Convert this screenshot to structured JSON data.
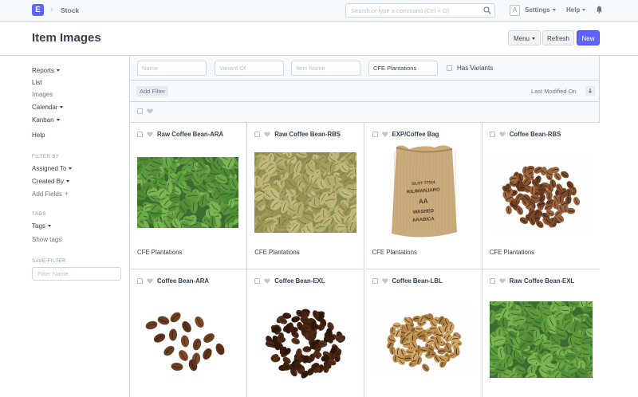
{
  "navbar": {
    "logo_letter": "E",
    "breadcrumb": "Stock",
    "search_placeholder": "Search or type a command (Ctrl + G)",
    "avatar_letter": "A",
    "settings_label": "Settings",
    "help_label": "Help"
  },
  "page": {
    "title": "Item Images",
    "menu_label": "Menu",
    "refresh_label": "Refresh",
    "new_label": "New"
  },
  "sidebar": {
    "views": [
      "Reports",
      "List",
      "Images",
      "Calendar",
      "Kanban",
      "Help"
    ],
    "filter_by_label": "FILTER BY",
    "assigned_to": "Assigned To",
    "created_by": "Created By",
    "add_fields": "Add Fields",
    "tags_label": "TAGS",
    "tags": "Tags",
    "show_tags": "Show tags",
    "save_filter_label": "SAVE FILTER",
    "filter_name_placeholder": "Filter Name"
  },
  "filters": {
    "name_placeholder": "Name",
    "variant_of_placeholder": "Variant Of",
    "item_name_placeholder": "Item Name",
    "item_group_value": "CFE Plantations",
    "has_variants_label": "Has Variants",
    "add_filter_label": "Add Filter",
    "sort_label": "Last Modified On"
  },
  "items": [
    {
      "title": "Raw Coffee Bean-ARA",
      "group": "CFE Plantations",
      "image": "green-coffee-beans"
    },
    {
      "title": "Raw Coffee Bean-RBS",
      "group": "CFE Plantations",
      "image": "pale-green-coffee-beans"
    },
    {
      "title": "EXP/Coffee Bag",
      "group": "CFE Plantations",
      "image": "burlap-coffee-sack"
    },
    {
      "title": "Coffee Bean-RBS",
      "group": "CFE Plantations",
      "image": "roasted-coffee-pile"
    },
    {
      "title": "Coffee Bean-ARA",
      "group": "",
      "image": "roasted-coffee-scatter"
    },
    {
      "title": "Coffee Bean-EXL",
      "group": "",
      "image": "dark-roasted-coffee-pile"
    },
    {
      "title": "Coffee Bean-LBL",
      "group": "",
      "image": "light-roasted-coffee-pile"
    },
    {
      "title": "Raw Coffee Bean-EXL",
      "group": "",
      "image": "green-coffee-beans"
    }
  ],
  "sack_label": [
    "5/LOT 77314",
    "KILIMANJARO",
    "AA",
    "WASHED",
    "ARABICA"
  ],
  "colors": {
    "accent": "#5e64ff",
    "border": "#d1d8dd",
    "text": "#36414c"
  }
}
